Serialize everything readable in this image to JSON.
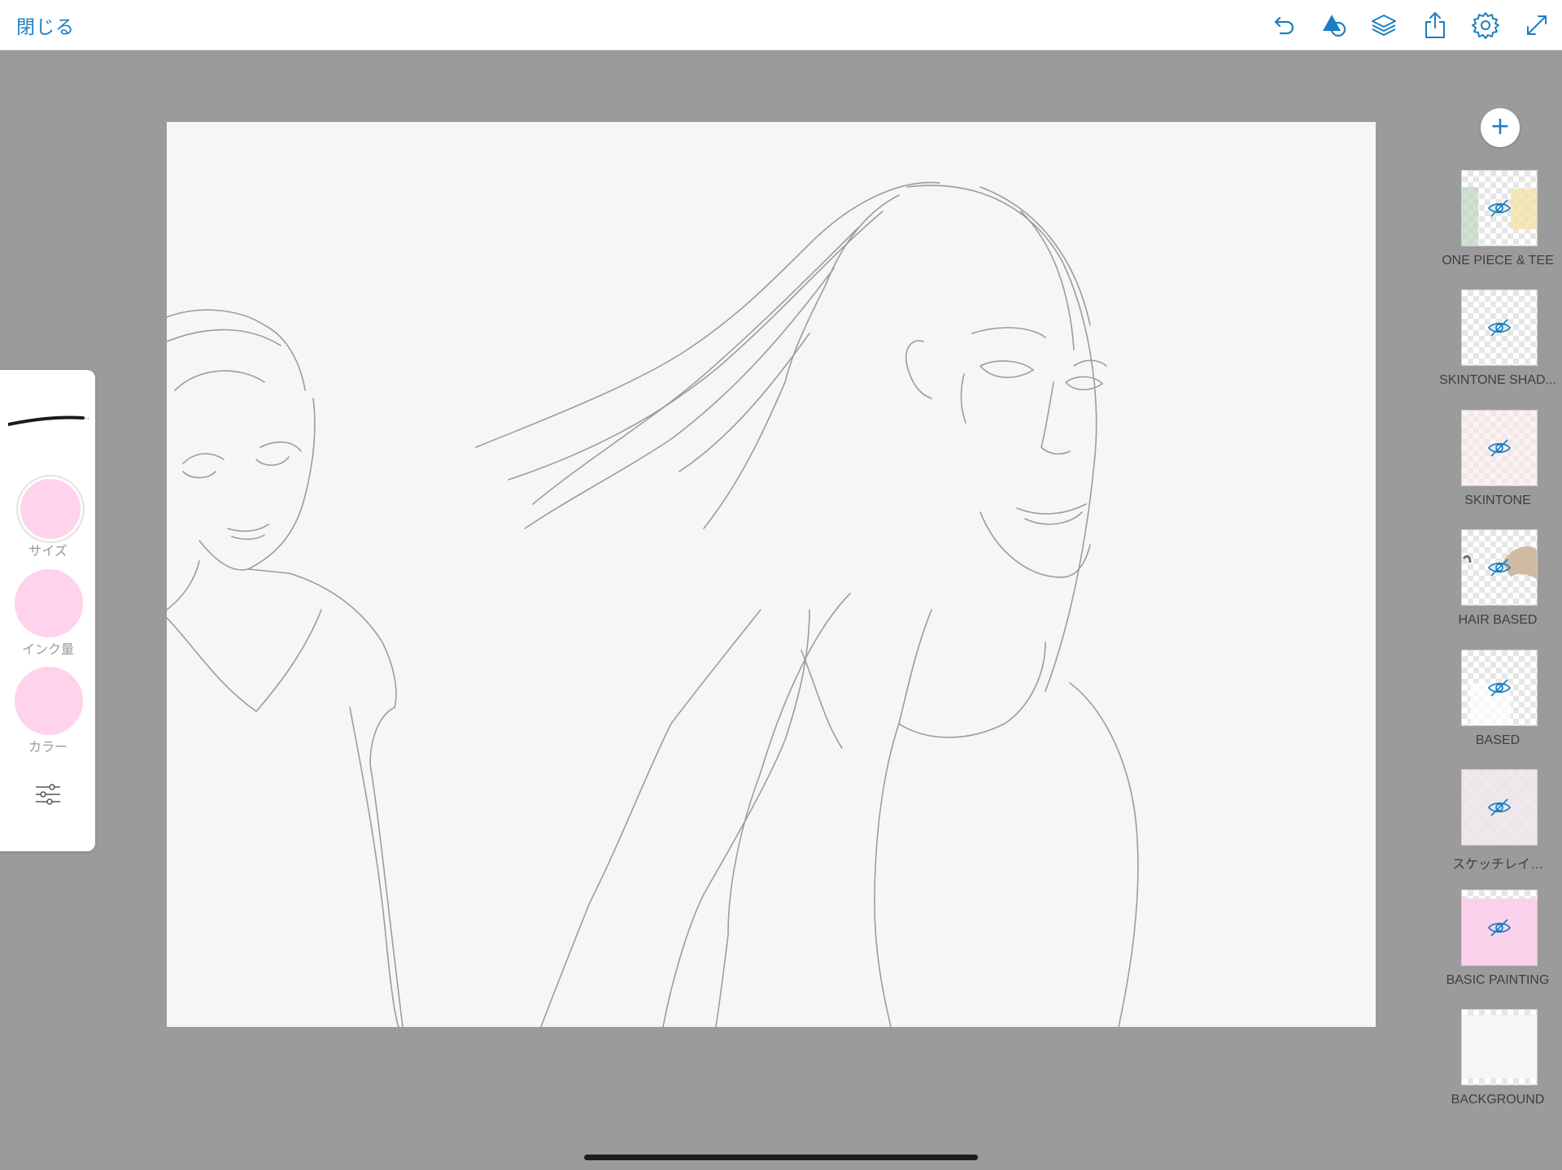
{
  "topbar": {
    "close_label": "閉じる",
    "icons": [
      "undo-icon",
      "shape-tool-icon",
      "layers-icon",
      "share-icon",
      "settings-gear-icon",
      "fullscreen-icon"
    ]
  },
  "colors": {
    "accent": "#1a7fc1",
    "workspace_bg": "#9b9b9b",
    "canvas_bg": "#f6f6f4",
    "swatch_pink": "#ffd3ec"
  },
  "brush_panel": {
    "size_label": "サイズ",
    "ink_label": "インク量",
    "color_label": "カラー",
    "settings_icon": "sliders-icon"
  },
  "layers": [
    {
      "name": "ONE PIECE & TEE",
      "visible": false
    },
    {
      "name": "SKINTONE SHAD...",
      "visible": false
    },
    {
      "name": "SKINTONE",
      "visible": false
    },
    {
      "name": "HAIR BASED",
      "visible": false
    },
    {
      "name": "BASED",
      "visible": false
    },
    {
      "name": "スケッチレイ…",
      "visible": false
    },
    {
      "name": "BASIC PAINTING",
      "visible": false
    },
    {
      "name": "BACKGROUND",
      "visible": true
    }
  ]
}
